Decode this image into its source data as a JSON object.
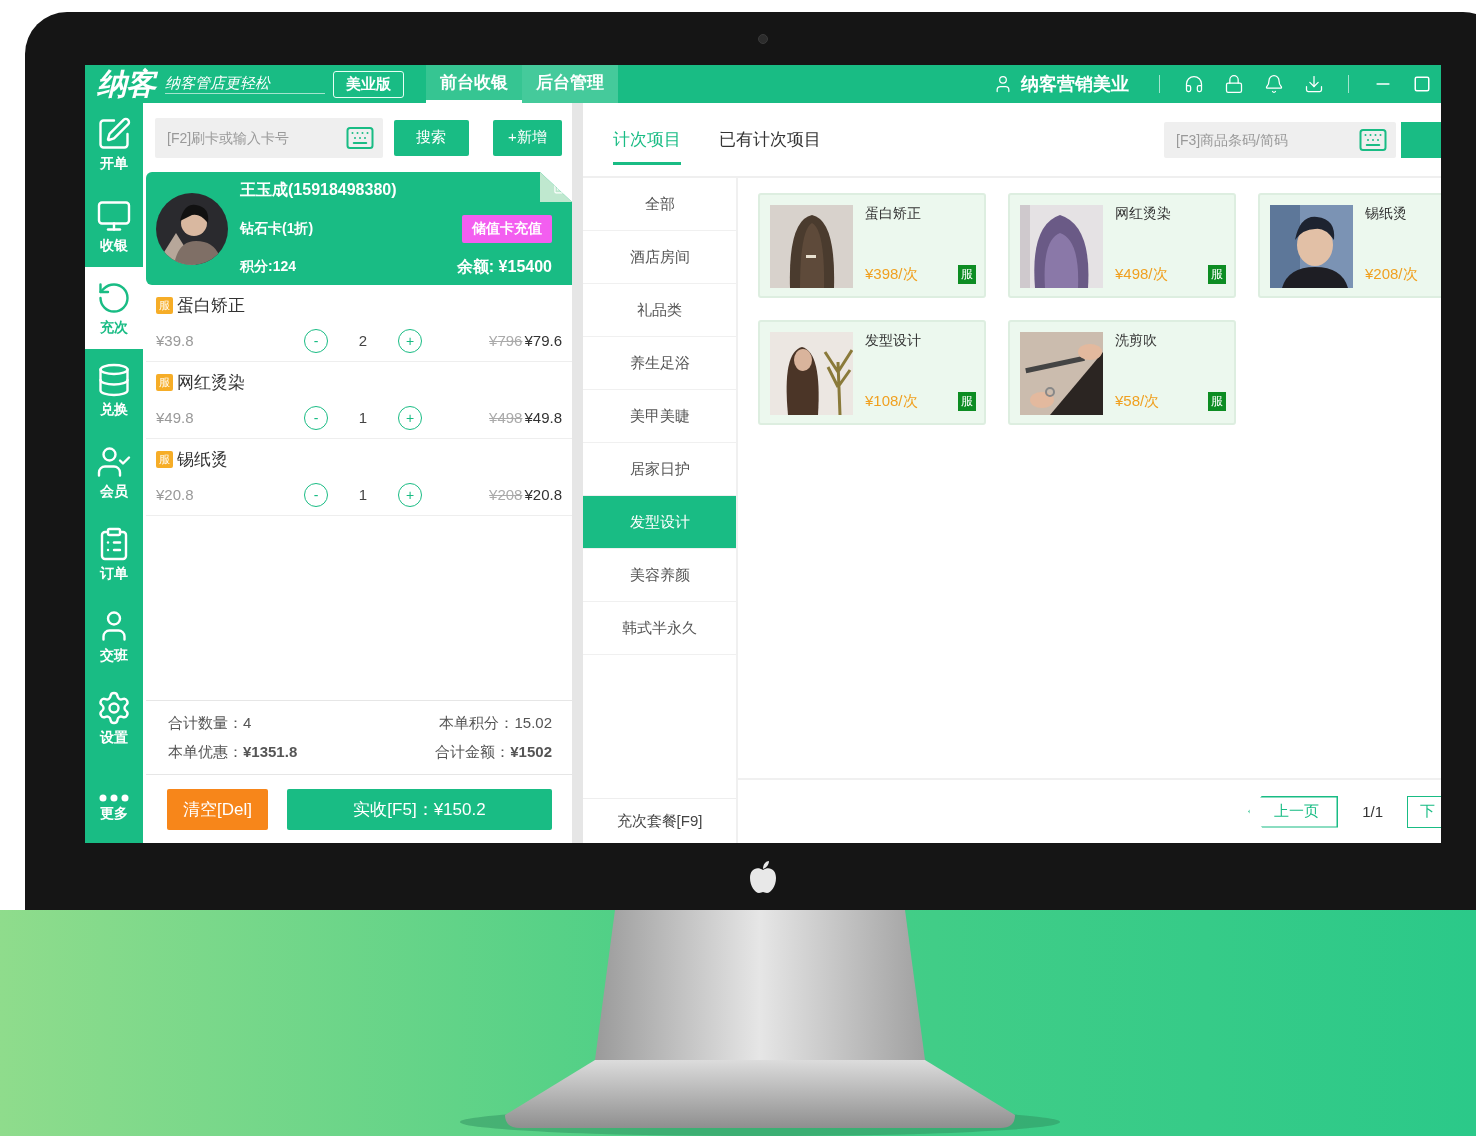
{
  "top_bar": {
    "logo": "纳客",
    "slogan": "纳客管店更轻松",
    "edition": "美业版",
    "tabs": [
      {
        "label": "前台收银",
        "selected": true
      },
      {
        "label": "后台管理",
        "selected": false
      }
    ],
    "user": "纳客营销美业"
  },
  "sidebar": {
    "items": [
      {
        "label": "开单",
        "selected": false
      },
      {
        "label": "收银",
        "selected": false
      },
      {
        "label": "充次",
        "selected": true
      },
      {
        "label": "兑换",
        "selected": false
      },
      {
        "label": "会员",
        "selected": false
      },
      {
        "label": "订单",
        "selected": false
      },
      {
        "label": "交班",
        "selected": false
      },
      {
        "label": "设置",
        "selected": false
      }
    ],
    "more": "更多"
  },
  "member_search": {
    "placeholder": "[F2]刷卡或输入卡号",
    "search_button": "搜索",
    "add_button": "+新增"
  },
  "member": {
    "name": "王玉成(15918498380)",
    "card": "钻石卡(1折)",
    "points": "积分:124",
    "recharge_button": "储值卡充值",
    "balance": "余额: ¥15400"
  },
  "cart": [
    {
      "tag": "服",
      "name": "蛋白矫正",
      "unit_price": "¥39.8",
      "minus": "-",
      "quantity": "2",
      "plus": "+",
      "original": "¥796",
      "total": "¥79.6"
    },
    {
      "tag": "服",
      "name": "网红烫染",
      "unit_price": "¥49.8",
      "minus": "-",
      "quantity": "1",
      "plus": "+",
      "original": "¥498",
      "total": "¥49.8"
    },
    {
      "tag": "服",
      "name": "锡纸烫",
      "unit_price": "¥20.8",
      "minus": "-",
      "quantity": "1",
      "plus": "+",
      "original": "¥208",
      "total": "¥20.8"
    }
  ],
  "summary": {
    "count": "合计数量：4",
    "points": "本单积分：15.02",
    "discount": "本单优惠：**¥1351.8**",
    "total": "合计金额：**¥1502**"
  },
  "actions": {
    "clear": "清空[Del]",
    "pay": "实收[F5]：¥150.2"
  },
  "product_tabs": [
    {
      "label": "计次项目",
      "selected": true
    },
    {
      "label": "已有计次项目",
      "selected": false
    }
  ],
  "product_search": {
    "placeholder": "[F3]商品条码/简码"
  },
  "categories": [
    {
      "label": "全部",
      "selected": false
    },
    {
      "label": "酒店房间",
      "selected": false
    },
    {
      "label": "礼品类",
      "selected": false
    },
    {
      "label": "养生足浴",
      "selected": false
    },
    {
      "label": "美甲美睫",
      "selected": false
    },
    {
      "label": "居家日护",
      "selected": false
    },
    {
      "label": "发型设计",
      "selected": true
    },
    {
      "label": "美容养颜",
      "selected": false
    },
    {
      "label": "韩式半永久",
      "selected": false
    }
  ],
  "package_button": "充次套餐[F9]",
  "products": [
    {
      "name": "蛋白矫正",
      "price": "¥398/次",
      "badge": "服"
    },
    {
      "name": "网红烫染",
      "price": "¥498/次",
      "badge": "服"
    },
    {
      "name": "锡纸烫",
      "price": "¥208/次"
    },
    {
      "name": "发型设计",
      "price": "¥108/次",
      "badge": "服"
    },
    {
      "name": "洗剪吹",
      "price": "¥58/次",
      "badge": "服"
    }
  ],
  "pager": {
    "prev": "上一页",
    "page": "1/1",
    "next": "下"
  }
}
